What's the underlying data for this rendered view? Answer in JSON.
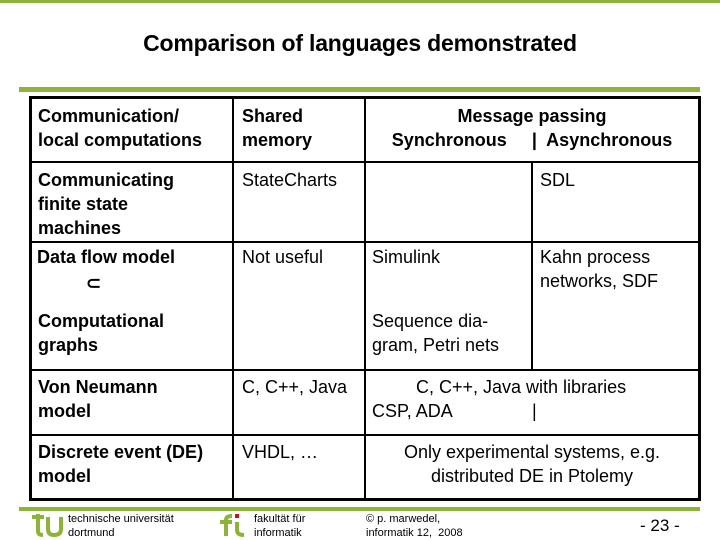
{
  "title": "Comparison of languages demonstrated",
  "colors": {
    "accent_green": "#8db33a",
    "logo_red": "#c8102e"
  },
  "table": {
    "header": {
      "col0": "Communication/\nlocal computations",
      "col1": "Shared\nmemory",
      "col2_line1": "Message passing",
      "col2_line2": "Synchronous     |  Asynchronous"
    },
    "rows": [
      {
        "label": "Communicating\nfinite state\nmachines",
        "shared": "StateCharts",
        "sync": "",
        "async": "SDL"
      },
      {
        "label": "Data flow model",
        "subset_symbol": "⊂",
        "shared": "Not useful",
        "sync": "Simulink",
        "async": "Kahn process\nnetworks, SDF"
      },
      {
        "label": "Computational\ngraphs",
        "shared": "",
        "sync": "Sequence dia-\ngram, Petri nets",
        "async": ""
      },
      {
        "label": "Von Neumann\nmodel",
        "shared": "C, C++, Java",
        "message_line1": "C, C++, Java with libraries",
        "message_line2": "CSP, ADA",
        "message_separator": "|"
      },
      {
        "label": "Discrete event (DE)\nmodel",
        "shared": "VHDL, …",
        "message": "Only experimental systems, e.g.\ndistributed DE in Ptolemy"
      }
    ]
  },
  "footer": {
    "tu_logo": "tu",
    "university": "technische universität\ndortmund",
    "fi_logo": "fi",
    "faculty": "fakultät für\ninformatik",
    "copyright": "© p. marwedel,\ninformatik 12,  2008",
    "page_number": "- 23 -"
  }
}
